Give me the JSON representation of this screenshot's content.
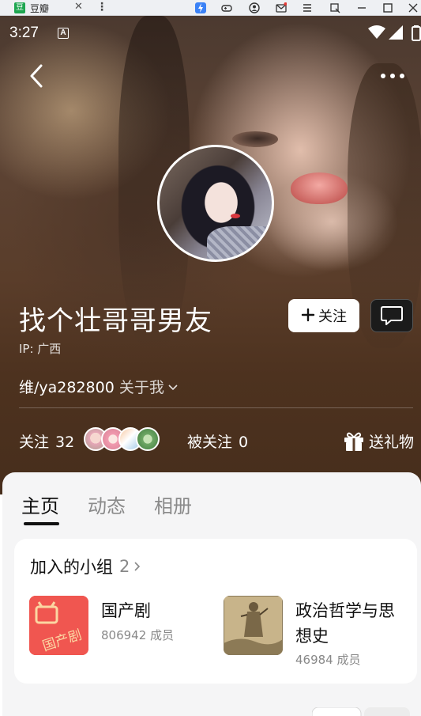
{
  "window": {
    "tab_title": "豆瓣",
    "app_icon_glyph": "豆",
    "close_glyph": "✕",
    "menu_glyph": "⋮",
    "tray_icons": [
      "thunder-icon",
      "gamepad-icon",
      "user-icon",
      "mail-icon",
      "menu-icon",
      "screenshot-icon",
      "minimize-icon",
      "maximize-icon",
      "close-icon"
    ]
  },
  "status_bar": {
    "time": "3:27",
    "notification_icon": "A"
  },
  "profile": {
    "name": "找个壮哥哥男友",
    "ip": "IP: 广西",
    "bio": "维/ya282800",
    "about_label": "关于我",
    "follow_label": "关注",
    "following_label": "关注",
    "following_count": "32",
    "followers_label": "被关注",
    "followers_count": "0",
    "gift_label": "送礼物"
  },
  "tabs": [
    {
      "label": "主页",
      "active": true
    },
    {
      "label": "动态",
      "active": false
    },
    {
      "label": "相册",
      "active": false
    }
  ],
  "groups_card": {
    "title": "加入的小组",
    "count": "2",
    "groups": [
      {
        "name": "国产剧",
        "members": "806942 成员",
        "thumb_text": "国产剧"
      },
      {
        "name": "政治哲学与思想史",
        "members": "46984 成员"
      }
    ]
  },
  "colors": {
    "follow_bg": "#ffffff",
    "thumb_red": "#f05650",
    "tab_active": "#111111",
    "tab_inactive": "#8a8a8a"
  }
}
